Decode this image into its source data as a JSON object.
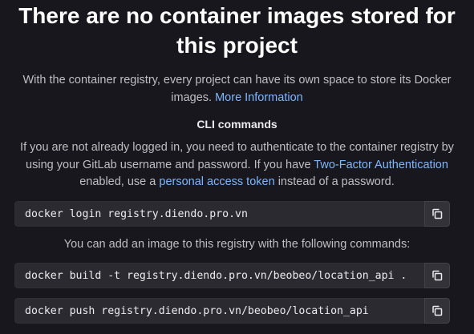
{
  "empty_state": {
    "title_line1": "There are no container images stored for",
    "title_line2": "this project",
    "intro_text": "With the container registry, every project can have its own space to store its Docker images.",
    "more_info_link": "More Information"
  },
  "cli": {
    "heading": "CLI commands",
    "auth_text_before": "If you are not already logged in, you need to authenticate to the container registry by using your GitLab username and password. If you have",
    "two_factor_link": "Two-Factor Authentication",
    "auth_text_middle": "enabled, use a",
    "pat_link": "personal access token",
    "auth_text_after": "instead of a password.",
    "login_command": "docker login registry.diendo.pro.vn",
    "add_image_text": "You can add an image to this registry with the following commands:",
    "build_command": "docker build -t registry.diendo.pro.vn/beobeo/location_api .",
    "push_command": "docker push registry.diendo.pro.vn/beobeo/location_api"
  },
  "icons": {
    "copy": "copy-icon"
  },
  "colors": {
    "background": "#18171d",
    "link": "#7eb6ff",
    "code_background": "#2b2a31"
  }
}
